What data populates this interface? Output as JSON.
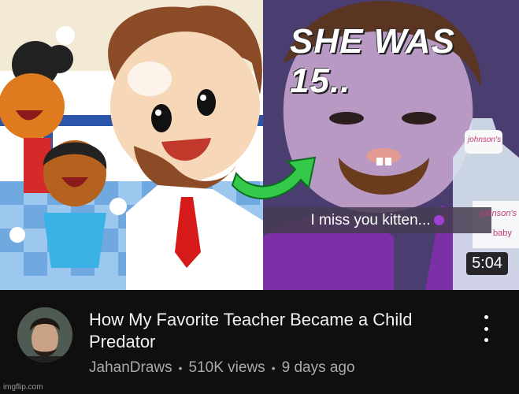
{
  "thumbnail": {
    "overlay_title": "SHE WAS 15..",
    "caption": "I miss you kitten...",
    "bottle_label_1": "johnson's",
    "bottle_label_2": "johnson's",
    "bottle_label_3": "baby",
    "duration": "5:04"
  },
  "video": {
    "title": "How My Favorite Teacher Became a Child Predator",
    "channel": "JahanDraws",
    "views": "510K views",
    "age": "9 days ago",
    "separator": "•"
  },
  "watermark": "imgflip.com"
}
